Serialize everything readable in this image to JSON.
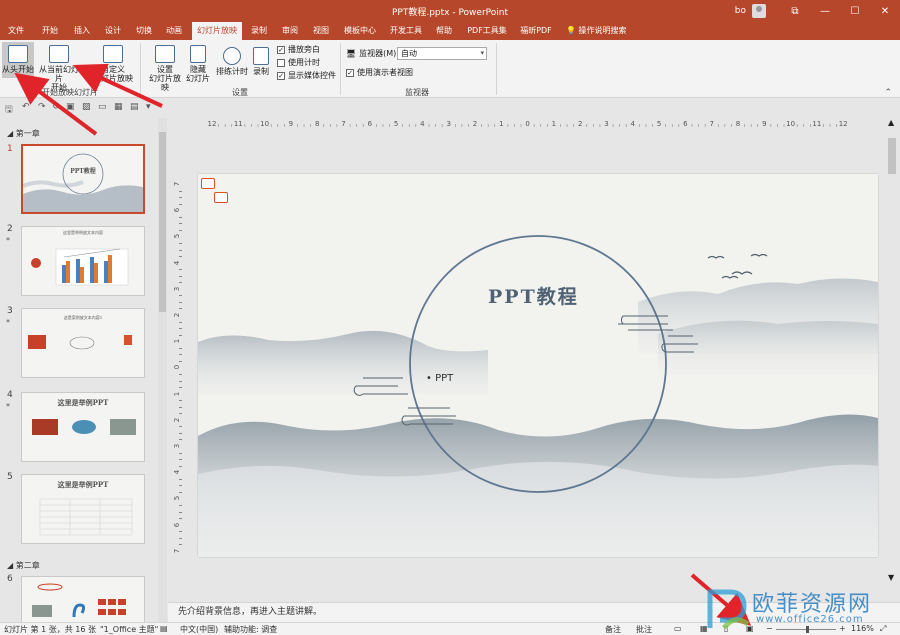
{
  "window": {
    "title": "PPT教程.pptx - PowerPoint",
    "user": "bo",
    "controls": {
      "restore": "⧉",
      "minimize": "—",
      "maximize": "☐",
      "close": "✕"
    }
  },
  "tabs": [
    "文件",
    "开始",
    "插入",
    "设计",
    "切换",
    "动画",
    "幻灯片放映",
    "录制",
    "审阅",
    "视图",
    "模板中心",
    "开发工具",
    "帮助",
    "PDF工具集",
    "福昕PDF"
  ],
  "active_tab": "幻灯片放映",
  "tell_me": "操作说明搜索",
  "ribbon": {
    "from_beginning": "从头开始",
    "from_current_line1": "从当前幻灯片",
    "from_current_line2": "开始",
    "custom_line1": "自定义",
    "custom_line2": "幻灯片放映",
    "group_start": "开始放映幻灯片",
    "setup_line1": "设置",
    "setup_line2": "幻灯片放映",
    "hide_line1": "隐藏",
    "hide_line2": "幻灯片",
    "rehearse": "排练计时",
    "record": "录制",
    "play_narrations": "播放旁白",
    "use_timings": "使用计时",
    "show_media_controls": "显示媒体控件",
    "group_setup": "设置",
    "monitor_label": "监视器(M):",
    "monitor_value": "自动",
    "presenter_view": "使用演示者视图",
    "group_monitor": "监视器"
  },
  "checkboxes": {
    "play_narrations": true,
    "use_timings": false,
    "show_media_controls": true,
    "presenter_view": true
  },
  "thumbnails": {
    "section1": "第一章",
    "section2": "第二章",
    "slide3_title": "这是案例放文本内容1",
    "slide4_title": "这里是举例PPT",
    "slide5_title": "这里是举例PPT",
    "slide1_title": "PPT教程",
    "slide2_title": "这里是举例放文本内容"
  },
  "slide": {
    "title": "PPT教程",
    "bullet": "• PPT"
  },
  "ruler_labels": [
    "12",
    "11",
    "10",
    "9",
    "8",
    "7",
    "6",
    "5",
    "4",
    "3",
    "2",
    "1",
    "0",
    "1",
    "2",
    "3",
    "4",
    "5",
    "6",
    "7",
    "8",
    "9",
    "10",
    "11",
    "12"
  ],
  "vruler_labels": [
    "7",
    "6",
    "5",
    "4",
    "3",
    "2",
    "1",
    "0",
    "1",
    "2",
    "3",
    "4",
    "5",
    "6",
    "7"
  ],
  "notes_text": "先介绍背景信息，再进入主题讲解。",
  "status": {
    "slide_info": "幻灯片 第 1 张，共 16 张",
    "theme": "\"1_Office 主题\"",
    "language": "中文(中国)",
    "accessibility": "辅助功能: 调查",
    "notes": "备注",
    "comments": "批注",
    "zoom": "116%"
  },
  "watermark": {
    "text": "欧菲资源网",
    "url": "www.office26.com"
  },
  "colors": {
    "accent": "#b7472a",
    "arrow": "#e0242a"
  }
}
